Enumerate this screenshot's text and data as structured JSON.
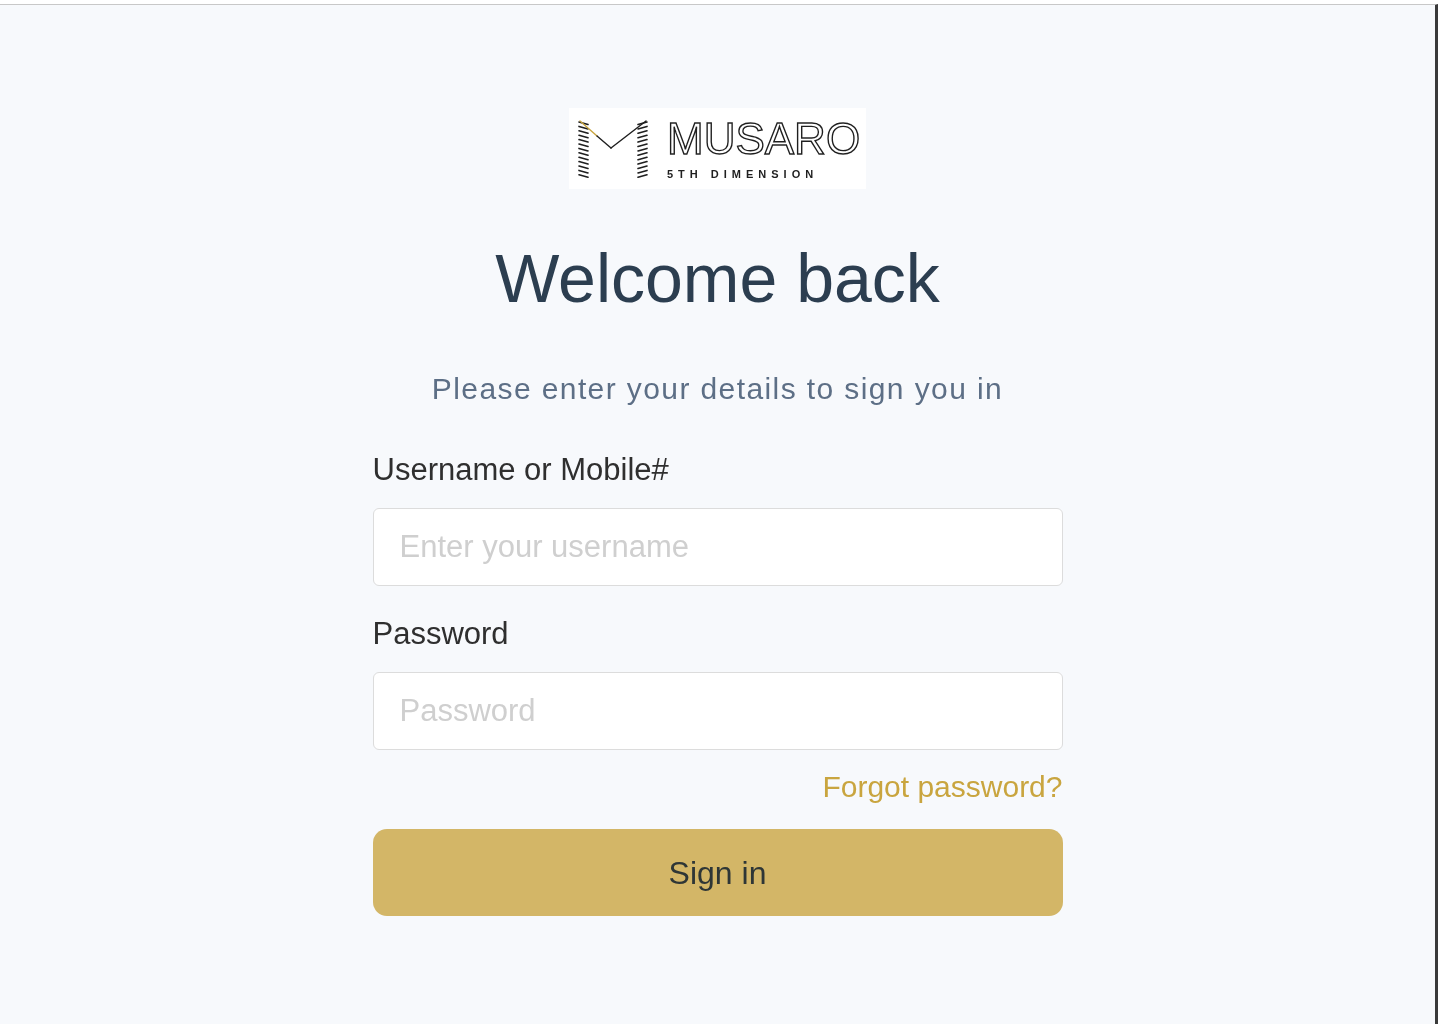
{
  "logo": {
    "wordmark": "MUSARO",
    "tagline": "5TH DIMENSION"
  },
  "heading": "Welcome back",
  "subtitle": "Please enter your details to sign you in",
  "fields": [
    {
      "label": "Username or Mobile#",
      "placeholder": "Enter your username"
    },
    {
      "label": "Password",
      "placeholder": "Password"
    }
  ],
  "forgot_link": "Forgot password?",
  "submit_button": "Sign in"
}
